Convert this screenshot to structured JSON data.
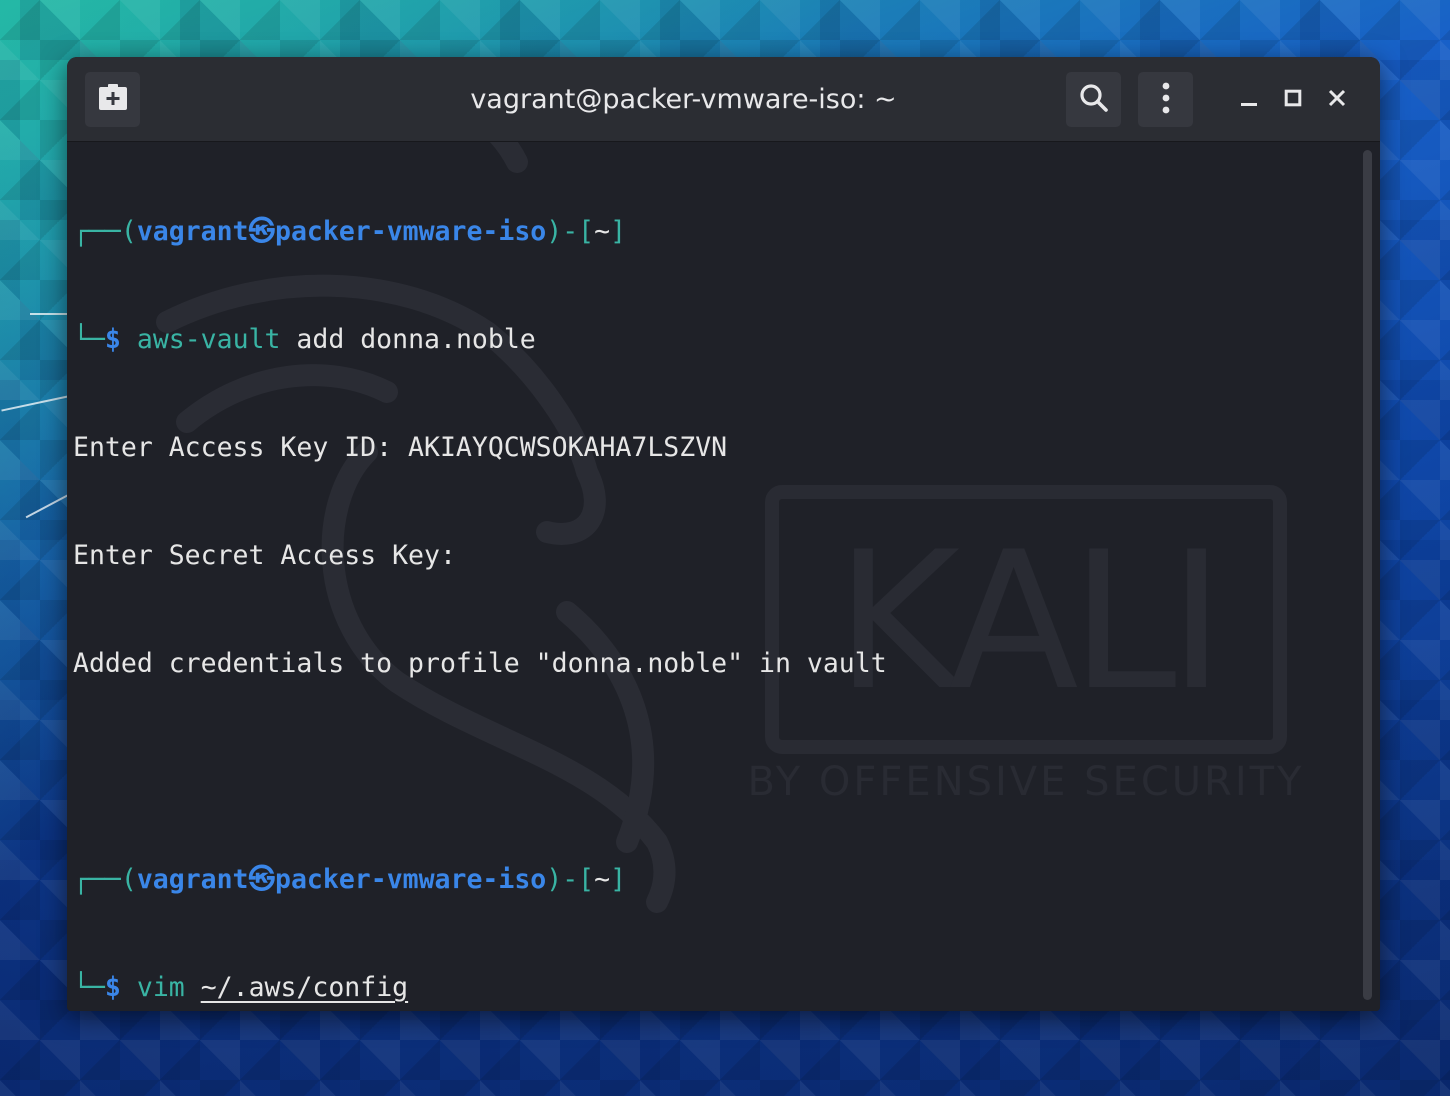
{
  "window": {
    "title": "vagrant@packer-vmware-iso: ~"
  },
  "icons": {
    "new_tab": "new-tab-icon",
    "search": "search-icon",
    "menu": "kebab-menu-icon",
    "minimize": "minimize-icon",
    "maximize": "maximize-icon",
    "close": "close-icon"
  },
  "colors": {
    "terminal_bg": "#1f2128",
    "prompt_user": "#3a86e8",
    "prompt_frame": "#39b4a4",
    "text": "#e6e6e6"
  },
  "terminal": {
    "prompt1": {
      "frame_top": "┌──(",
      "user": "vagrant",
      "at_symbol": "㉿",
      "host": "packer-vmware-iso",
      "mid": ")-[",
      "cwd": "~",
      "end": "]",
      "frame_bottom": "└─",
      "dollar": "$",
      "command": "aws-vault",
      "args": " add donna.noble"
    },
    "output": [
      "Enter Access Key ID: AKIAYQCWSOKAHA7LSZVN",
      "Enter Secret Access Key:",
      "Added credentials to profile \"donna.noble\" in vault"
    ],
    "prompt2": {
      "frame_top": "┌──(",
      "user": "vagrant",
      "at_symbol": "㉿",
      "host": "packer-vmware-iso",
      "mid": ")-[",
      "cwd": "~",
      "end": "]",
      "frame_bottom": "└─",
      "dollar": "$",
      "command": "vim",
      "space": " ",
      "path": "~/.aws/config"
    }
  },
  "watermark": {
    "logo_text": "KALI",
    "tagline": "BY OFFENSIVE SECURITY"
  }
}
